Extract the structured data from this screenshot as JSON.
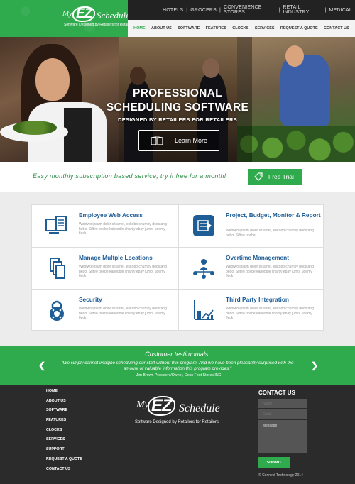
{
  "logo": {
    "my": "My",
    "ez": "EZ",
    "schedule": "Schedule",
    "tagline": "Software Designed by Retailers for Retailers"
  },
  "industry_bar": [
    "HOTELS",
    "GROCERS",
    "CONVENIENCE STORES",
    "RETAIL INDUSTRY",
    "MEDICAL"
  ],
  "nav": [
    "HOME",
    "ABOUT US",
    "SOFTWARE",
    "FEATURES",
    "CLOCKS",
    "SERVICES",
    "REQUEST A QUOTE",
    "CONTACT US"
  ],
  "hero": {
    "title_line1": "PROFESSIONAL",
    "title_line2": "SCHEDULING SOFTWARE",
    "subtitle": "DESIGNED BY RETAILERS FOR RETAILERS",
    "learn_more": "Learn More"
  },
  "promo": {
    "text": "Easy monthly subscription based service, try it free for a month!",
    "button": "Free Trial"
  },
  "features": [
    {
      "title": "Employee Web Access",
      "icon": "web-access-icon",
      "desc": "Webtwo ipsum dolor sit amet, eskobo chumby doostang bebo. Sifteo boxbe kaboodle chartly ebay jumo, udemy fleck"
    },
    {
      "title": "Project, Budget, Monitor & Report",
      "icon": "report-icon",
      "desc": "Webtwo ipsum dolor sit amet, eskobo chumby doostang bebo. Sifteo boxbe"
    },
    {
      "title": "Manage Multple Locations",
      "icon": "locations-icon",
      "desc": "Webtwo ipsum dolor sit amet, eskobo chumby doostang bebo. Sifteo boxbe kaboodle chartly ebay jumo, udemy fleck"
    },
    {
      "title": "Overtime Management",
      "icon": "overtime-icon",
      "desc": "Webtwo ipsum dolor sit amet, eskobo chumby doostang bebo. Sifteo boxbe kaboodle chartly ebay jumo, udemy fleck"
    },
    {
      "title": "Security",
      "icon": "security-icon",
      "desc": "Webtwo ipsum dolor sit amet, eskobo chumby doostang bebo. Sifteo boxbe kaboodle chartly ebay jumo, udemy fleck"
    },
    {
      "title": "Third Party Integration",
      "icon": "integration-icon",
      "desc": "Webtwo ipsum dolor sit amet, eskobo chumby doostang bebo. Sifteo boxbe kaboodle chartly ebay jumo, udemy fleck"
    }
  ],
  "testimonials": {
    "title": "Customer testimonials:",
    "quote": "“We simply cannot imagine scheduling our staff without this program. And we have been pleasantly surprised with the amount of valuable information this program provides.”",
    "author": "- Jim Brown President/Owner, Docs Foot Stores INC",
    "prev": "❮",
    "next": "❯"
  },
  "footer": {
    "links": [
      "HOME",
      "ABOUT US",
      "SOFTWARE",
      "FEATURES",
      "CLOCKS",
      "SERVICES",
      "SUPPORT",
      "REQUEST A QUOTE",
      "CONTACT US"
    ],
    "contact_title": "CONTACT US",
    "name_placeholder": "Name",
    "email_placeholder": "Email",
    "message_placeholder": "Message",
    "submit": "SUBMIT",
    "copyright": "© Connect Technology 2014"
  },
  "colors": {
    "brand_green": "#2faa4d",
    "title_blue": "#1f5d96",
    "dark": "#2b2b2b"
  }
}
